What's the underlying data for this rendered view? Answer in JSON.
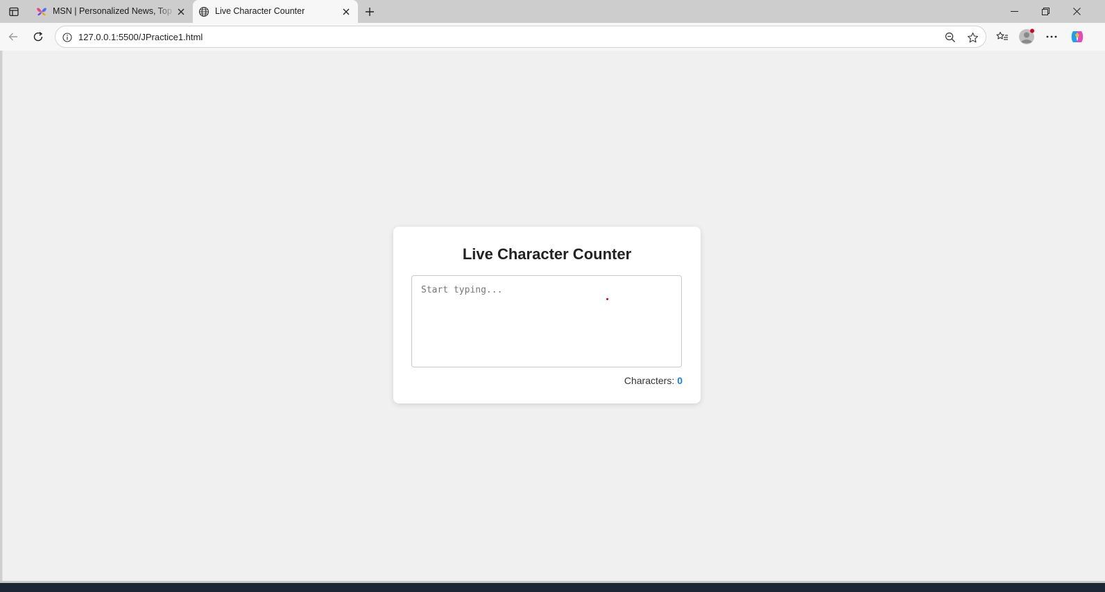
{
  "browser": {
    "tabs": [
      {
        "title": "MSN | Personalized News, Top Headlines, Live Updates and more",
        "favicon": "msn-butterfly-icon",
        "active": false
      },
      {
        "title": "Live Character Counter",
        "favicon": "globe-icon",
        "active": true
      }
    ],
    "url": "127.0.0.1:5500/JPractice1.html"
  },
  "page": {
    "title": "Live Character Counter",
    "textarea_placeholder": "Start typing...",
    "textarea_value": "",
    "counter_label": "Characters:",
    "counter_value": "0"
  },
  "colors": {
    "counter_accent": "#1a7ee6",
    "page_background": "#f0f0f0",
    "card_background": "#ffffff",
    "cursor_dot": "#d0021b"
  }
}
